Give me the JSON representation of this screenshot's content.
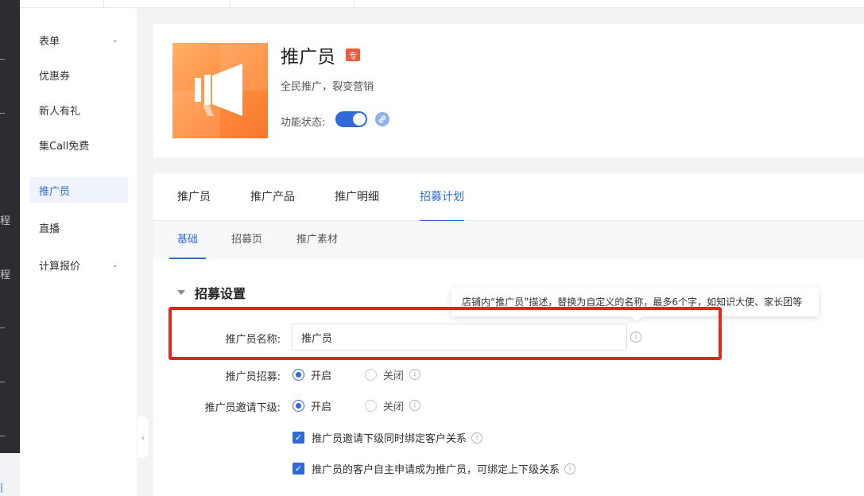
{
  "dark_nav": {
    "fragments": [
      "程",
      "程"
    ]
  },
  "sidebar": {
    "items": [
      {
        "label": "表单",
        "chevron": "chevron-down"
      },
      {
        "label": "优惠券"
      },
      {
        "label": "新人有礼"
      },
      {
        "label": "集Call免费"
      },
      {
        "label": "推广员",
        "active": true
      },
      {
        "label": "直播"
      },
      {
        "label": "计算报价",
        "chevron": "chevron-down"
      }
    ]
  },
  "header": {
    "title": "推广员",
    "badge": "专",
    "subtitle": "全民推广，裂变营销",
    "status_label": "功能状态:",
    "status_enabled": true
  },
  "tabs": [
    {
      "label": "推广员"
    },
    {
      "label": "推广产品"
    },
    {
      "label": "推广明细"
    },
    {
      "label": "招募计划",
      "active": true
    }
  ],
  "subtabs": [
    {
      "label": "基础",
      "active": true
    },
    {
      "label": "招募页"
    },
    {
      "label": "推广素材"
    }
  ],
  "section": {
    "title": "招募设置"
  },
  "tooltip": {
    "text": "店铺内“推广员”描述，替换为自定义的名称，最多6个字，如知识大使、家长团等"
  },
  "form": {
    "name_label": "推广员名称:",
    "name_value": "推广员",
    "recruit_label": "推广员招募:",
    "invite_label": "推广员邀请下级:",
    "on_label": "开启",
    "off_label": "关闭",
    "check1": "推广员邀请下级同时绑定客户关系",
    "check2": "推广员的客户自主申请成为推广员，可绑定上下级关系"
  },
  "colors": {
    "accent": "#2f6bd8",
    "highlight_box": "#e8231c",
    "badge": "#ef5a3c",
    "promo_orange": "#ff8d3e"
  }
}
